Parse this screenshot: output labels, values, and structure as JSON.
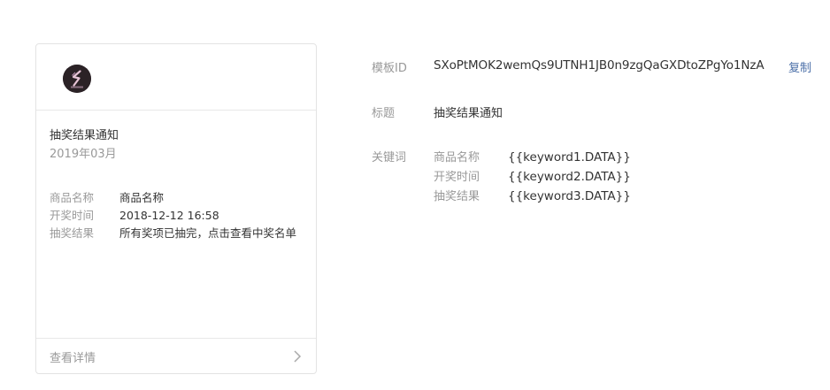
{
  "preview": {
    "title": "抽奖结果通知",
    "date": "2019年03月",
    "fields": [
      {
        "key": "商品名称",
        "value": "商品名称"
      },
      {
        "key": "开奖时间",
        "value": "2018-12-12 16:58"
      },
      {
        "key": "抽奖结果",
        "value": "所有奖项已抽完，点击查看中奖名单"
      }
    ],
    "footer_link": "查看详情",
    "avatar_icon": "logo-s-icon"
  },
  "info": {
    "template_id_label": "模板ID",
    "template_id": "SXoPtMOK2wemQs9UTNH1JB0n9zgQaGXDtoZPgYo1NzA",
    "copy_label": "复制",
    "title_label": "标题",
    "title_value": "抽奖结果通知",
    "keywords_label": "关键词",
    "keywords": [
      {
        "name": "商品名称",
        "value": "{{keyword1.DATA}}"
      },
      {
        "name": "开奖时间",
        "value": "{{keyword2.DATA}}"
      },
      {
        "name": "抽奖结果",
        "value": "{{keyword3.DATA}}"
      }
    ]
  },
  "colors": {
    "link": "#4b6fa8",
    "muted": "#999999",
    "text": "#333333",
    "border": "#e3e3e3"
  }
}
